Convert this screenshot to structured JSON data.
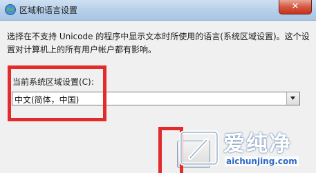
{
  "window": {
    "title": "区域和语言设置",
    "close_symbol": "✕"
  },
  "content": {
    "description": "选择在不支持 Unicode 的程序中显示文本时所使用的语言(系统区域设置)。这个设置对计算机上的所有用户帐户都有影响。",
    "current_label": "当前系统区域设置(C):",
    "current_value": "中文(简体，中国)"
  },
  "watermark": {
    "brand": "爱纯净",
    "url": "aichunjing.com"
  },
  "colors": {
    "highlight_box": "#e42b2b",
    "accent_blue": "#2c68c7"
  },
  "icons": {
    "title": "globe-icon",
    "dropdown": "chevron-down-icon"
  }
}
